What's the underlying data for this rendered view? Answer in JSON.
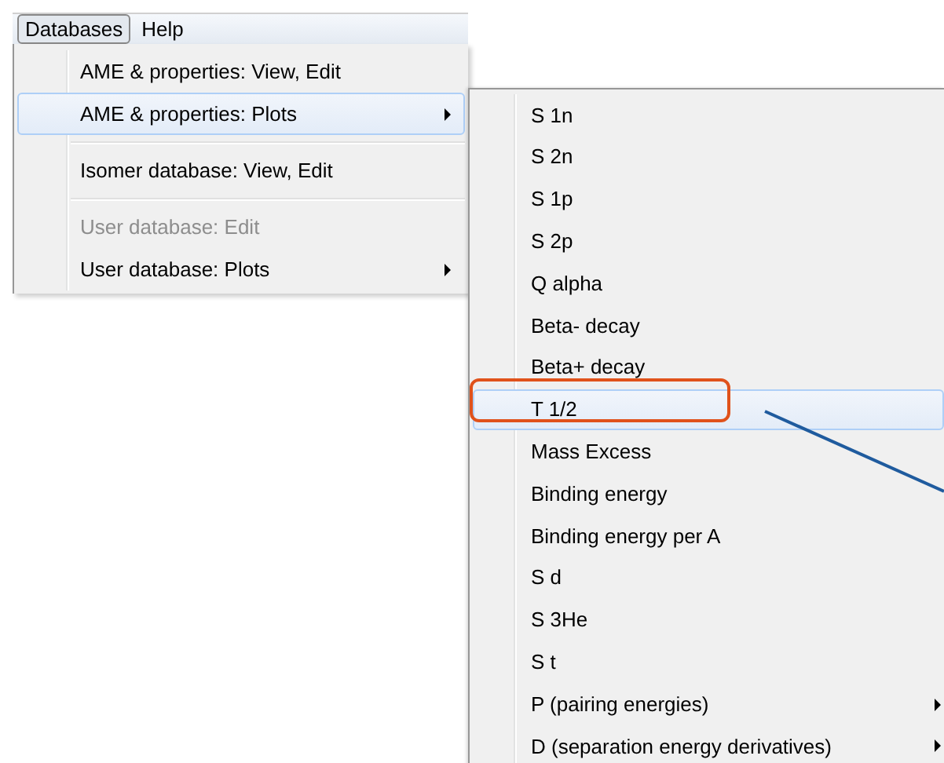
{
  "menubar": [
    {
      "label": "Databases",
      "selected": true
    },
    {
      "label": "Help",
      "selected": false
    }
  ],
  "menu": [
    {
      "kind": "item",
      "label": "AME & properties: View, Edit",
      "disabled": false,
      "highlighted": false,
      "submenu": false
    },
    {
      "kind": "item",
      "label": "AME & properties: Plots",
      "disabled": false,
      "highlighted": true,
      "submenu": true
    },
    {
      "kind": "separator"
    },
    {
      "kind": "item",
      "label": "Isomer database: View, Edit",
      "disabled": false,
      "highlighted": false,
      "submenu": false
    },
    {
      "kind": "separator"
    },
    {
      "kind": "item",
      "label": "User database: Edit",
      "disabled": true,
      "highlighted": false,
      "submenu": false
    },
    {
      "kind": "item",
      "label": "User database: Plots",
      "disabled": false,
      "highlighted": false,
      "submenu": true
    }
  ],
  "submenu": [
    {
      "label": "S 1n",
      "highlighted": false,
      "circled": false,
      "submenu": false
    },
    {
      "label": "S 2n",
      "highlighted": false,
      "circled": false,
      "submenu": false
    },
    {
      "label": "S 1p",
      "highlighted": false,
      "circled": false,
      "submenu": false
    },
    {
      "label": "S 2p",
      "highlighted": false,
      "circled": false,
      "submenu": false
    },
    {
      "label": "Q alpha",
      "highlighted": false,
      "circled": false,
      "submenu": false
    },
    {
      "label": "Beta- decay",
      "highlighted": false,
      "circled": false,
      "submenu": false
    },
    {
      "label": "Beta+ decay",
      "highlighted": false,
      "circled": false,
      "submenu": false
    },
    {
      "label": "T 1/2",
      "highlighted": true,
      "circled": true,
      "submenu": false
    },
    {
      "label": "Mass Excess",
      "highlighted": false,
      "circled": false,
      "submenu": false
    },
    {
      "label": "Binding energy",
      "highlighted": false,
      "circled": false,
      "submenu": false
    },
    {
      "label": "Binding energy per A",
      "highlighted": false,
      "circled": false,
      "submenu": false
    },
    {
      "label": "S d",
      "highlighted": false,
      "circled": false,
      "submenu": false
    },
    {
      "label": "S 3He",
      "highlighted": false,
      "circled": false,
      "submenu": false
    },
    {
      "label": "S t",
      "highlighted": false,
      "circled": false,
      "submenu": false
    },
    {
      "label": "P (pairing energies)",
      "highlighted": false,
      "circled": false,
      "submenu": true
    },
    {
      "label": "D (separation energy derivatives)",
      "highlighted": false,
      "circled": false,
      "submenu": true
    }
  ]
}
